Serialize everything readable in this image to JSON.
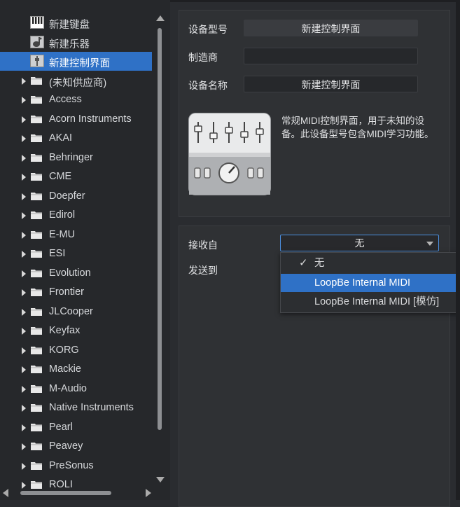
{
  "tree": {
    "devices": [
      {
        "label": "新建键盘",
        "icon": "keyboard-icon"
      },
      {
        "label": "新建乐器",
        "icon": "instrument-icon"
      },
      {
        "label": "新建控制界面",
        "icon": "control-surface-icon",
        "selected": true
      }
    ],
    "folders": [
      "(未知供应商)",
      "Access",
      "Acorn Instruments",
      "AKAI",
      "Behringer",
      "CME",
      "Doepfer",
      "Edirol",
      "E-MU",
      "ESI",
      "Evolution",
      "Frontier",
      "JLCooper",
      "Keyfax",
      "KORG",
      "Mackie",
      "M-Audio",
      "Native Instruments",
      "Pearl",
      "Peavey",
      "PreSonus",
      "ROLI"
    ]
  },
  "device": {
    "model_label": "设备型号",
    "model_value": "新建控制界面",
    "maker_label": "制造商",
    "maker_value": "",
    "name_label": "设备名称",
    "name_value": "新建控制界面",
    "description": "常规MIDI控制界面，用于未知的设备。此设备型号包含MIDI学习功能。"
  },
  "ports": {
    "receive_label": "接收自",
    "receive_value": "无",
    "send_label": "发送到"
  },
  "menu": {
    "items": [
      {
        "label": "无",
        "checked": true
      },
      {
        "label": "LoopBe Internal MIDI",
        "highlighted": true
      },
      {
        "label": "LoopBe Internal MIDI [模仿]"
      }
    ]
  },
  "colors": {
    "accent": "#2f71c6",
    "background": "#2a2c30"
  }
}
